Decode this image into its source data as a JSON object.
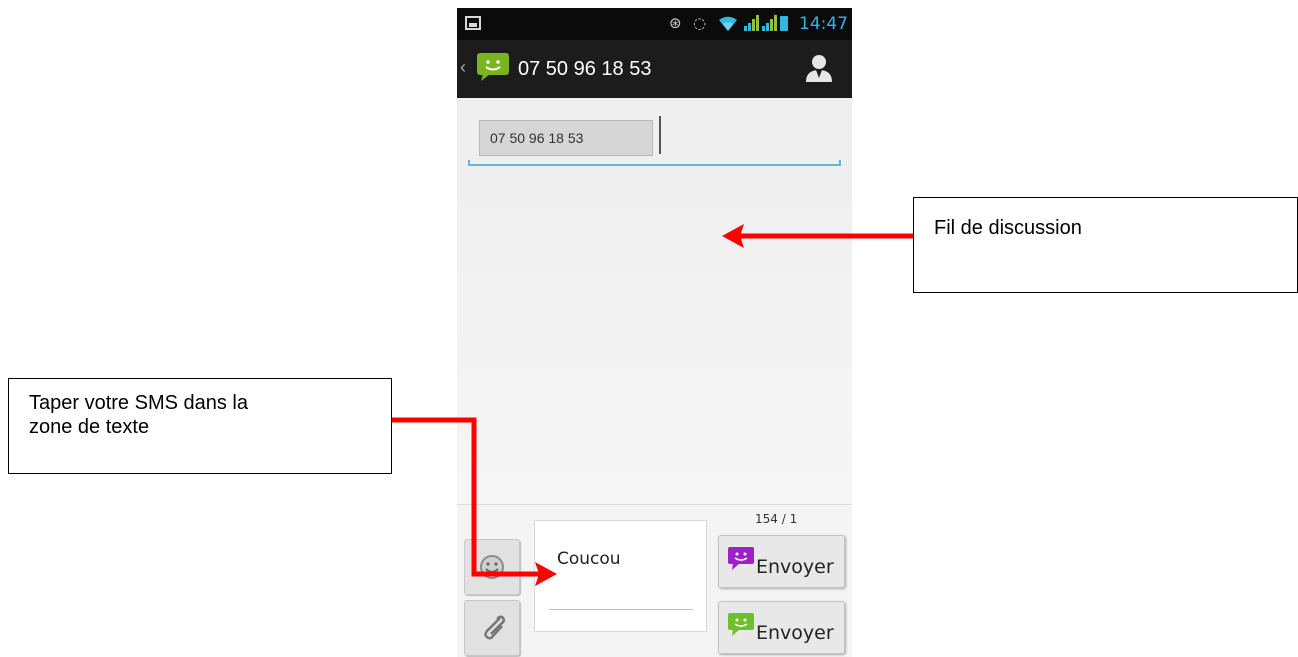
{
  "status_bar": {
    "time": "14:47",
    "icons": [
      "image-icon",
      "bluetooth-icon",
      "alarm-icon",
      "wifi-icon",
      "signal-icon",
      "signal-icon",
      "battery-icon"
    ]
  },
  "action_bar": {
    "title": "07 50 96 18 53",
    "icons": [
      "back-chevron-icon",
      "messaging-app-icon",
      "contact-icon"
    ]
  },
  "recipient": {
    "chip_label": "07 50 96 18 53"
  },
  "compose": {
    "message_text": "Coucou",
    "char_counter": "154 / 1",
    "send_buttons": [
      {
        "label": "Envoyer",
        "color": "#a020c8"
      },
      {
        "label": "Envoyer",
        "color": "#6fbf2a"
      }
    ],
    "side_icons": [
      "smiley-icon",
      "paperclip-icon"
    ]
  },
  "annotations": {
    "thread_callout": "Fil de discussion",
    "compose_callout_line1": "Taper votre SMS dans la",
    "compose_callout_line2": "zone de texte",
    "arrow_color": "#ff0000"
  },
  "colors": {
    "accent": "#33b5e5",
    "actionbar_bg": "#1c1c1c",
    "statusbar_bg": "#0b0b0b",
    "app_green": "#7ab51d"
  }
}
